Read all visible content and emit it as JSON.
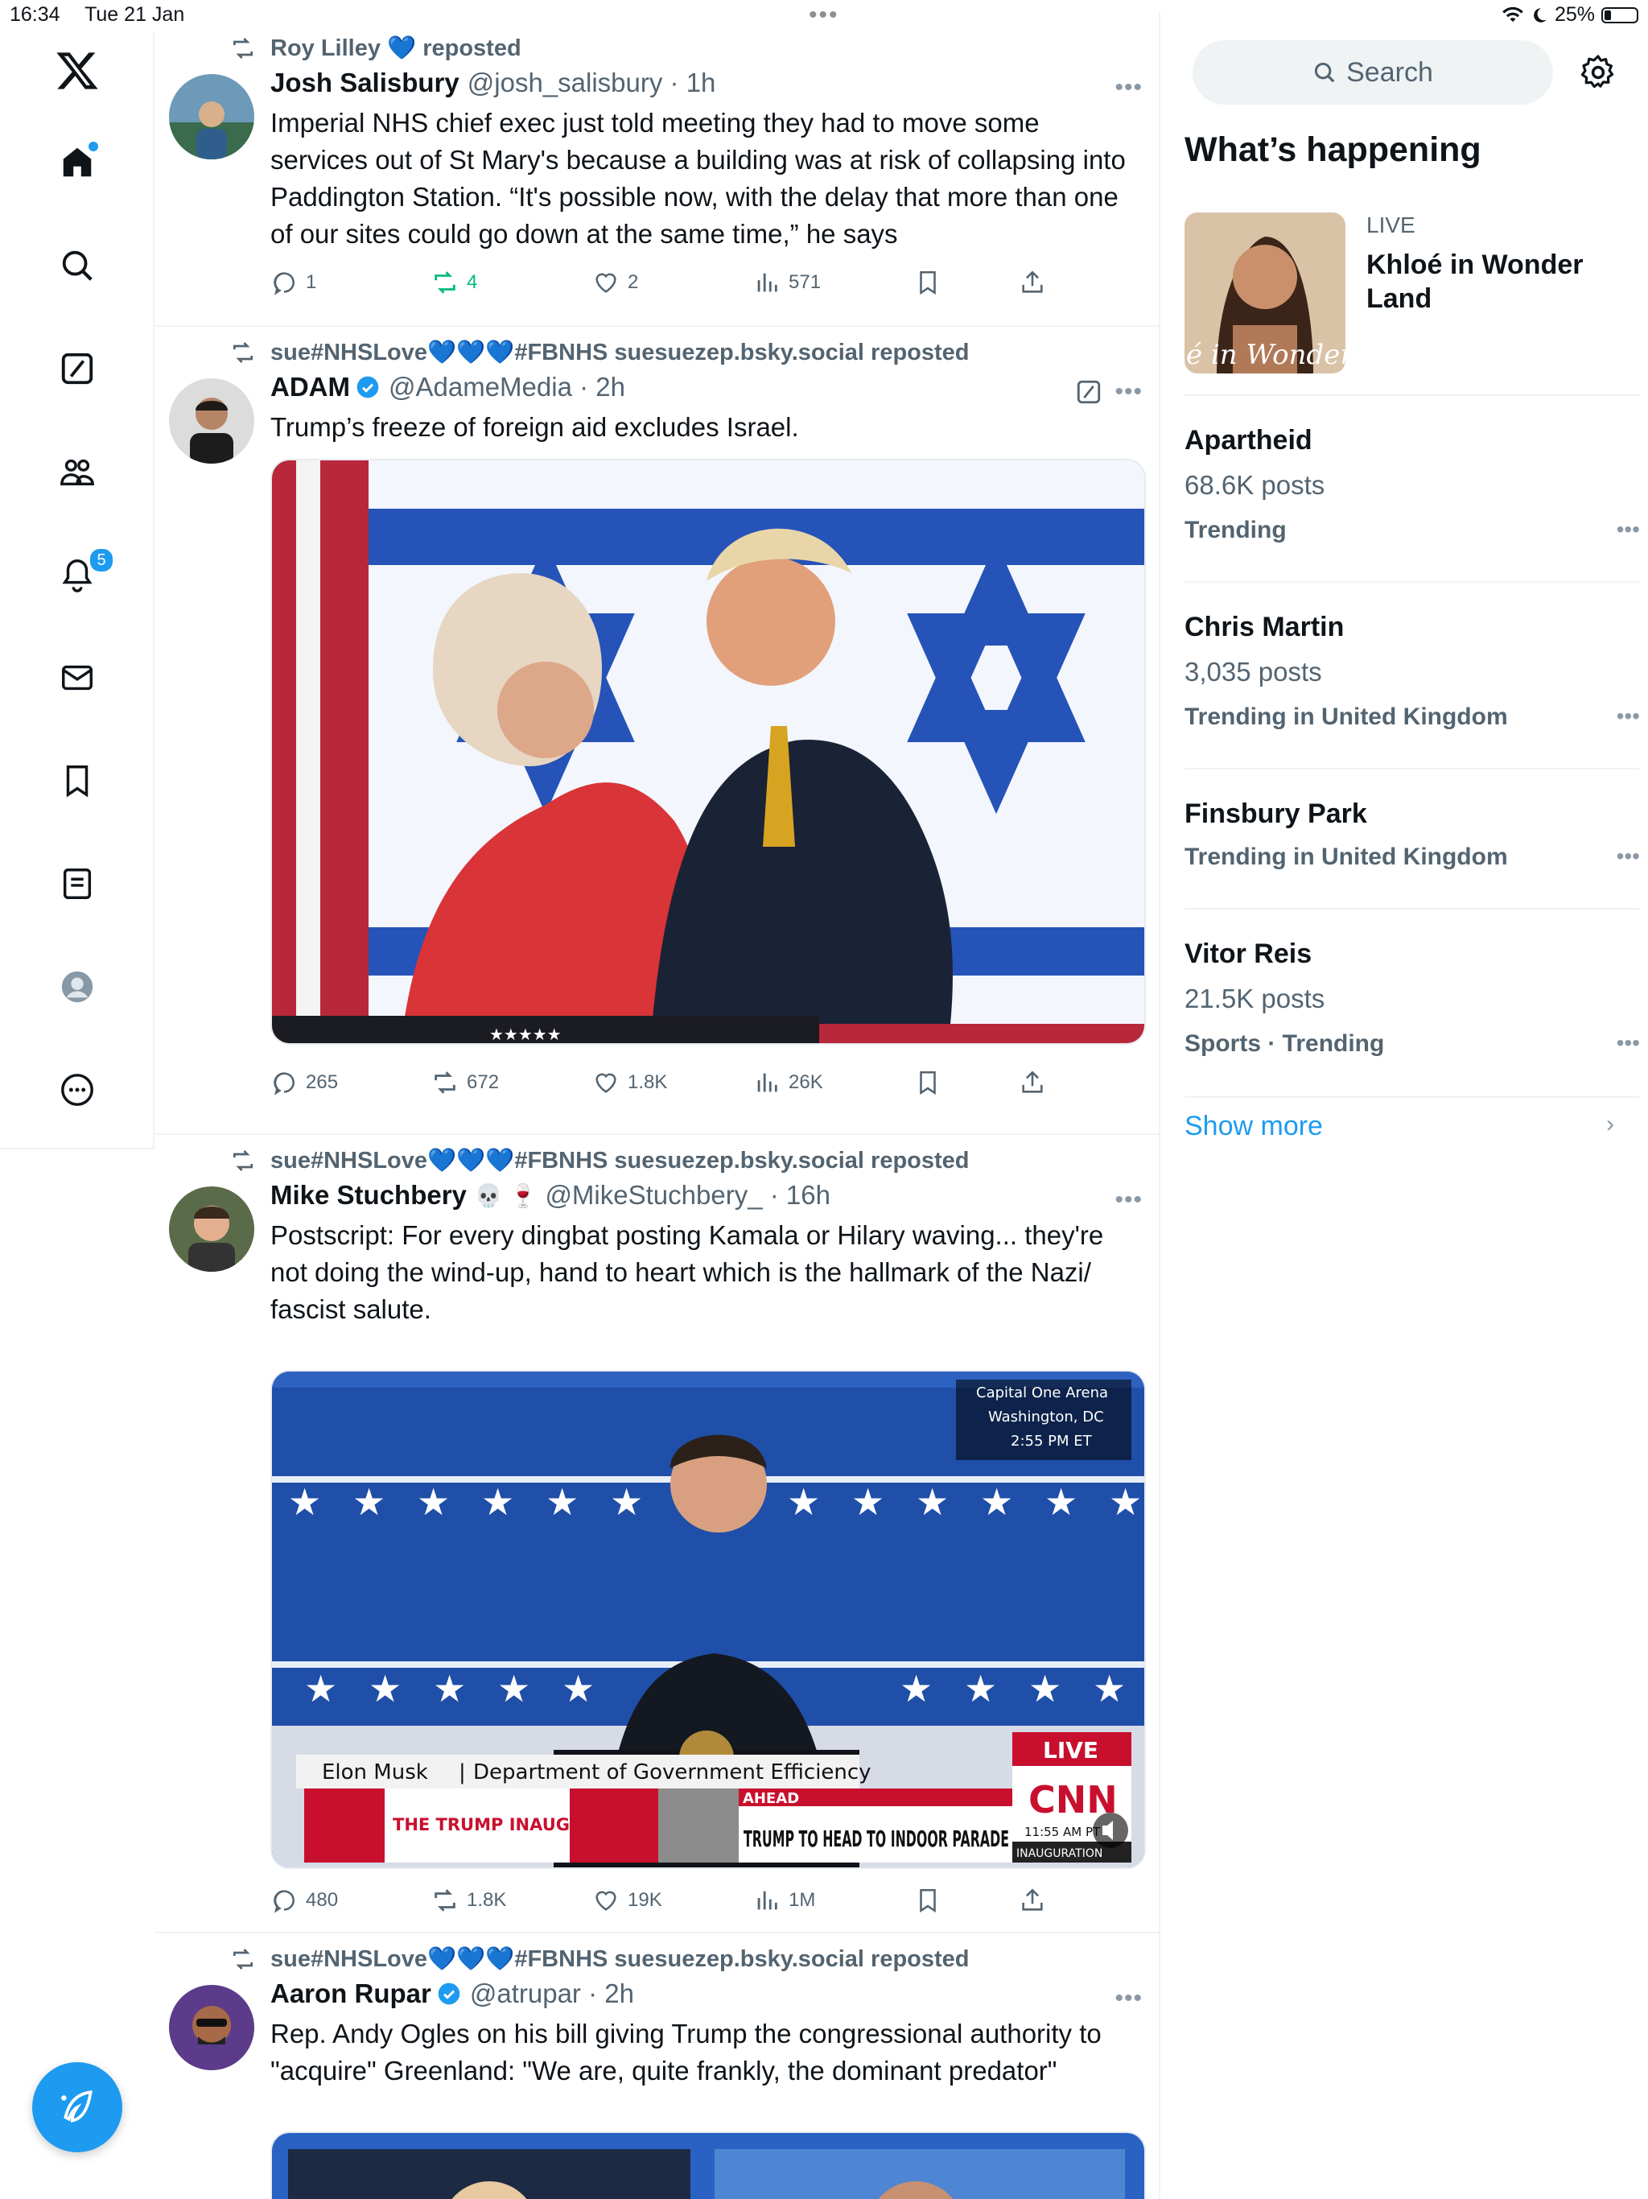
{
  "status_bar": {
    "time": "16:34",
    "date": "Tue 21 Jan",
    "battery": "25%",
    "battery_level": 0.25
  },
  "nav": {
    "notifications_badge": "5",
    "compose_label": ""
  },
  "posts": [
    {
      "repost_by": "Roy Lilley 💙 reposted",
      "name": "Josh Salisbury",
      "handle": "@josh_salisbury · 1h",
      "text": "Imperial NHS chief exec just told meeting they had to move some services out of St Mary's because a building was at risk of collapsing into Paddington Station. “It's possible now, with the delay that more than one of our sites could go down at the same time,” he says",
      "replies": "1",
      "reposts": "4",
      "likes": "2",
      "views": "571"
    },
    {
      "repost_by": "sue#NHSLove💙💙💙#FBNHS suesuezep.bsky.social reposted",
      "name": "ADAM",
      "handle": "@AdameMedia · 2h",
      "text": "Trump’s freeze of foreign aid excludes Israel.",
      "replies": "265",
      "reposts": "672",
      "likes": "1.8K",
      "views": "26K",
      "media_caption": "★★★★★"
    },
    {
      "repost_by": "sue#NHSLove💙💙💙#FBNHS suesuezep.bsky.social reposted",
      "name": "Mike Stuchbery",
      "name_emoji": "💀 🍷",
      "handle": "@MikeStuchbery_ · 16h",
      "text": "Postscript: For every dingbat posting Kamala or Hilary waving... they're not doing the wind-up, hand to heart which is the hallmark of the Nazi/ fascist salute.",
      "replies": "480",
      "reposts": "1.8K",
      "likes": "19K",
      "views": "1M",
      "video": {
        "venue": "Capital One Arena",
        "city": "Washington, DC",
        "time": "2:55 PM ET",
        "lower_third": "Elon Musk",
        "lower_third_title": "Department of Government Efficiency",
        "banner_logo": "THE TRUMP INAUGURAL PARADE",
        "ahead": "AHEAD",
        "headline": "TRUMP TO HEAD TO INDOOR PARADE",
        "live": "LIVE",
        "network": "CNN",
        "clock": "11:55 AM PT",
        "tag": "INAUGURATION"
      }
    },
    {
      "repost_by": "sue#NHSLove💙💙💙#FBNHS suesuezep.bsky.social reposted",
      "name": "Aaron Rupar",
      "handle": "@atrupar · 2h",
      "text": "Rep. Andy Ogles on his bill giving Trump the congressional authority to \"acquire\" Greenland: \"We are, quite frankly, the dominant predator\""
    }
  ],
  "sidebar": {
    "search_placeholder": "Search",
    "whats_happening": "What’s happening",
    "live": {
      "label": "LIVE",
      "title": "Khloé in Wonder Land",
      "image_text": "é in Wonder l"
    },
    "trends": [
      {
        "name": "Apartheid",
        "count": "68.6K posts",
        "meta": "Trending"
      },
      {
        "name": "Chris Martin",
        "count": "3,035 posts",
        "meta": "Trending in United Kingdom"
      },
      {
        "name": "Finsbury Park",
        "count": "",
        "meta": "Trending in United Kingdom"
      },
      {
        "name": "Vitor Reis",
        "count": "21.5K posts",
        "meta": "Sports · Trending"
      }
    ],
    "show_more": "Show more"
  },
  "colors": {
    "accent": "#1d9bf0",
    "repost_green": "#00ba7c",
    "muted": "#536471"
  }
}
